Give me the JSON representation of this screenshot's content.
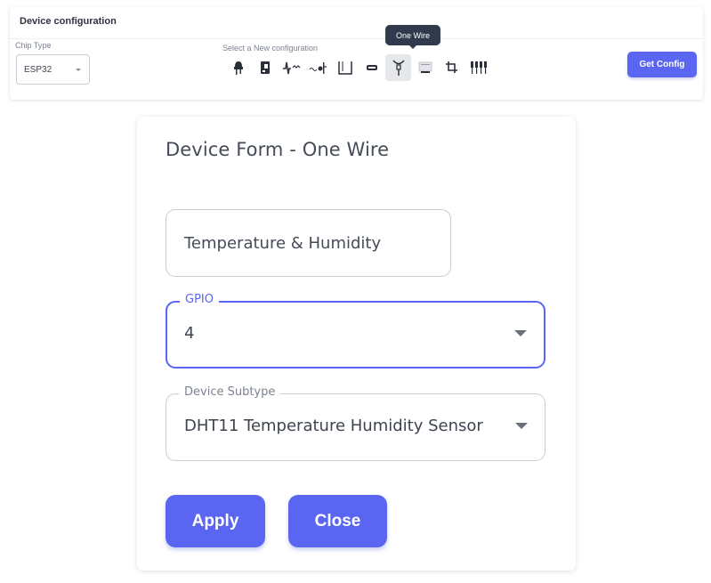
{
  "config_bar": {
    "title": "Device configuration",
    "chip_type_label": "Chip Type",
    "chip_type_value": "ESP32",
    "select_label": "Select a New configuration",
    "tooltip": "One Wire",
    "get_config_label": "Get Config",
    "icons": [
      {
        "name": "led-icon",
        "active": false
      },
      {
        "name": "relay-module-icon",
        "active": false
      },
      {
        "name": "waveform-icon",
        "active": false
      },
      {
        "name": "analog-signal-icon",
        "active": false
      },
      {
        "name": "bracket-box-icon",
        "active": false
      },
      {
        "name": "display-module-icon",
        "active": false
      },
      {
        "name": "one-wire-icon",
        "active": true
      },
      {
        "name": "bus-board-icon",
        "active": false
      },
      {
        "name": "crop-connector-icon",
        "active": false
      },
      {
        "name": "multi-pin-connector-icon",
        "active": false
      }
    ]
  },
  "form": {
    "title": "Device Form - One Wire",
    "name_value": "Temperature & Humidity",
    "gpio_label": "GPIO",
    "gpio_value": "4",
    "subtype_label": "Device Subtype",
    "subtype_value": "DHT11 Temperature Humidity Sensor",
    "apply_label": "Apply",
    "close_label": "Close"
  }
}
